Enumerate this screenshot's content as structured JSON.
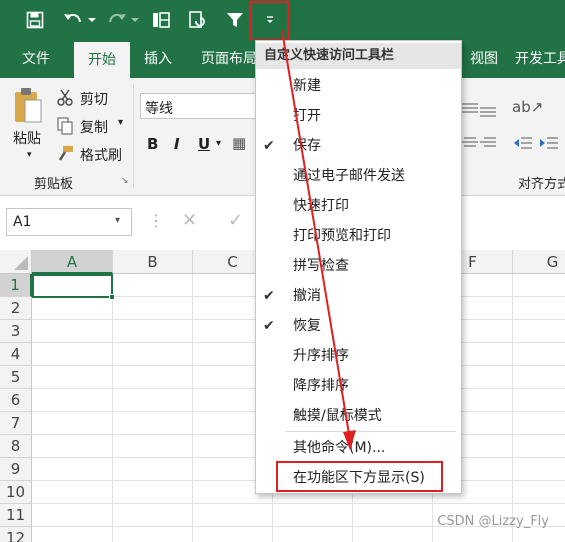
{
  "qat": {
    "icons": [
      "save-icon",
      "undo-icon",
      "redo-icon",
      "freeze-panes-icon",
      "refresh-icon",
      "filter-icon",
      "chevron-down-icon"
    ]
  },
  "tabs": [
    "文件",
    "开始",
    "插入",
    "页面布局",
    "视图",
    "开发工具"
  ],
  "ribbon": {
    "clipboard": {
      "paste": "粘贴",
      "cut": "剪切",
      "copy": "复制",
      "format_painter": "格式刷",
      "group_label": "剪贴板"
    },
    "font": {
      "font_name": "等线",
      "bold": "B",
      "italic": "I",
      "underline": "U"
    },
    "alignment": {
      "group_label": "对齐方式"
    }
  },
  "formula_bar": {
    "name_box": "A1"
  },
  "grid": {
    "columns": [
      "A",
      "B",
      "C",
      "D",
      "E",
      "F",
      "G"
    ],
    "rows": [
      "1",
      "2",
      "3",
      "4",
      "5",
      "6",
      "7",
      "8",
      "9",
      "10",
      "11",
      "12"
    ],
    "selected_cell": "A1"
  },
  "menu": {
    "title": "自定义快速访问工具栏",
    "items": [
      {
        "label": "新建",
        "checked": false
      },
      {
        "label": "打开",
        "checked": false
      },
      {
        "label": "保存",
        "checked": true
      },
      {
        "label": "通过电子邮件发送",
        "checked": false
      },
      {
        "label": "快速打印",
        "checked": false
      },
      {
        "label": "打印预览和打印",
        "checked": false
      },
      {
        "label": "拼写检查",
        "checked": false
      },
      {
        "label": "撤消",
        "checked": true
      },
      {
        "label": "恢复",
        "checked": true
      },
      {
        "label": "升序排序",
        "checked": false
      },
      {
        "label": "降序排序",
        "checked": false
      },
      {
        "label": "触摸/鼠标模式",
        "checked": false
      }
    ],
    "more_commands": "其他命令(M)...",
    "show_below": "在功能区下方显示(S)"
  },
  "watermark": "CSDN @Lizzy_Fly",
  "colors": {
    "excel_green": "#217346",
    "annotation_red": "#e02020"
  }
}
